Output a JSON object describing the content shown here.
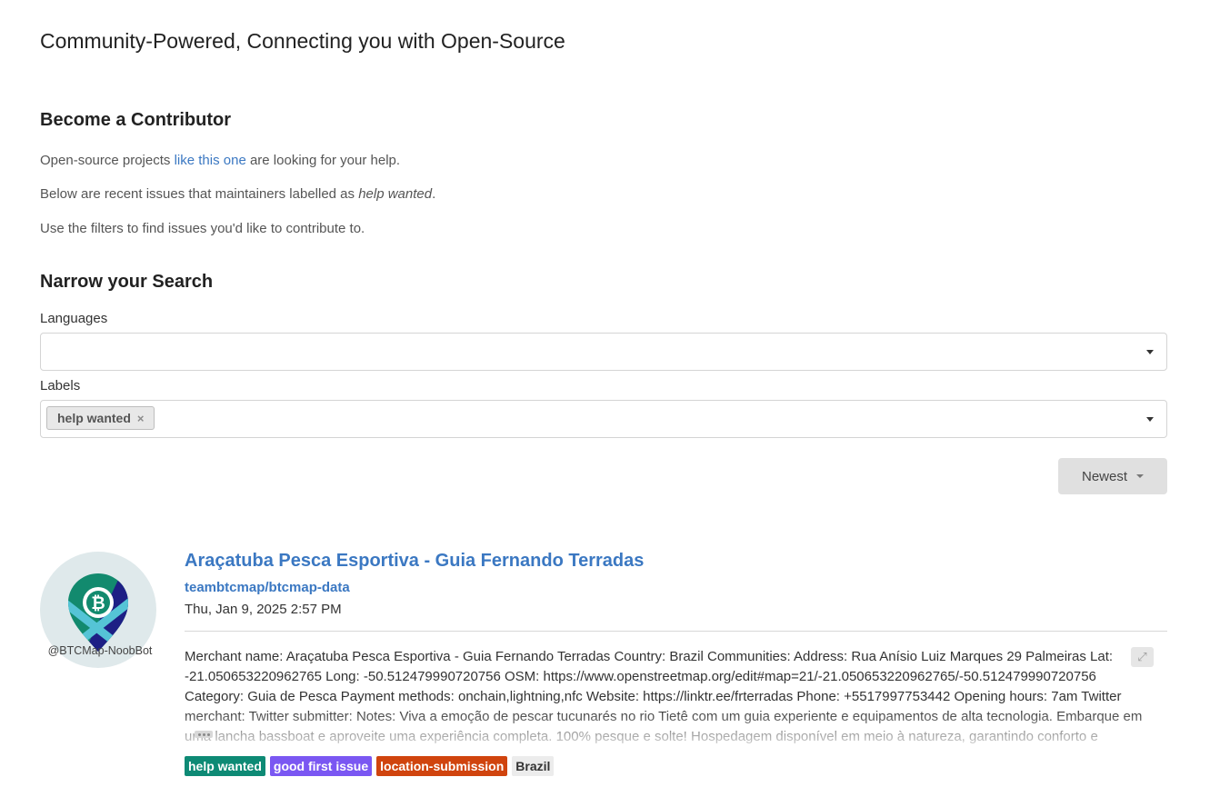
{
  "header": {
    "title": "Community-Powered, Connecting you with Open-Source"
  },
  "contributor": {
    "heading": "Become a Contributor",
    "line1_prefix": "Open-source projects ",
    "line1_link": "like this one",
    "line1_suffix": " are looking for your help.",
    "line2_prefix": "Below are recent issues that maintainers labelled as ",
    "line2_em": "help wanted",
    "line2_suffix": ".",
    "line3": "Use the filters to find issues you'd like to contribute to."
  },
  "search": {
    "heading": "Narrow your Search",
    "languages_label": "Languages",
    "labels_label": "Labels",
    "selected_label": "help wanted",
    "remove_icon": "×",
    "sort_label": "Newest"
  },
  "issue": {
    "avatar_handle": "@BTCMap-NoobBot",
    "title": "Araçatuba Pesca Esportiva - Guia Fernando Terradas",
    "repo": "teambtcmap/btcmap-data",
    "date": "Thu, Jan 9, 2025 2:57 PM",
    "body": "Merchant name: Araçatuba Pesca Esportiva - Guia Fernando Terradas Country: Brazil Communities: Address: Rua Anísio Luiz Marques 29 Palmeiras Lat: -21.050653220962765 Long: -50.512479990720756 OSM: https://www.openstreetmap.org/edit#map=21/-21.050653220962765/-50.512479990720756 Category: Guia de Pesca Payment methods: onchain,lightning,nfc Website: https://linktr.ee/frterradas Phone: +5517997753442 Opening hours: 7am Twitter merchant: Twitter submitter: Notes: Viva a emoção de pescar tucunarés no rio Tietê com um guia experiente e equipamentos de alta tecnologia. Embarque em uma lancha bassboat e aproveite uma experiência completa. 100% pesque e solte! Hospedagem disponível em meio à natureza, garantindo conforto e",
    "expand_icon": "⤢",
    "tags": [
      {
        "label": "help wanted",
        "color": "#0e8a75",
        "text_color": "#ffffff"
      },
      {
        "label": "good first issue",
        "color": "#7a57f2",
        "text_color": "#ffffff"
      },
      {
        "label": "location-submission",
        "color": "#d0440e",
        "text_color": "#ffffff"
      },
      {
        "label": "Brazil",
        "color": "#ececec",
        "text_color": "#333333"
      }
    ]
  },
  "colors": {
    "link": "#3b78c2",
    "sort_button_bg": "#e0e0e0"
  }
}
